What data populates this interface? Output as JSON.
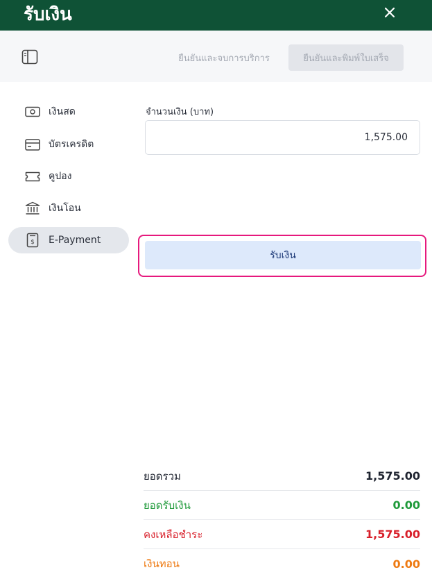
{
  "header": {
    "title": "รับเงิน",
    "close_glyph": "✕"
  },
  "toolbar": {
    "confirm_finish_label": "ยืนยันและจบการบริการ",
    "confirm_print_label": "ยืนยันและพิมพ์ใบเสร็จ"
  },
  "methods": [
    {
      "label": "เงินสด",
      "icon": "cash-icon",
      "active": false
    },
    {
      "label": "บัตรเครดิต",
      "icon": "credit-card-icon",
      "active": false
    },
    {
      "label": "คูปอง",
      "icon": "coupon-icon",
      "active": false
    },
    {
      "label": "เงินโอน",
      "icon": "bank-icon",
      "active": false
    },
    {
      "label": "E-Payment",
      "icon": "receipt-icon",
      "active": true
    }
  ],
  "form": {
    "amount_label": "จำนวนเงิน (บาท)",
    "amount_value": "1,575.00",
    "receive_button": "รับเงิน"
  },
  "summary": [
    {
      "label": "ยอดรวม",
      "value": "1,575.00",
      "color": "#1f2430"
    },
    {
      "label": "ยอดรับเงิน",
      "value": "0.00",
      "color": "#1f9a3a"
    },
    {
      "label": "คงเหลือชำระ",
      "value": "1,575.00",
      "color": "#d81f2a"
    },
    {
      "label": "เงินทอน",
      "value": "0.00",
      "color": "#ee7a12"
    }
  ],
  "colors": {
    "header_bg": "#0f5236",
    "highlight": "#e6197d",
    "primary_btn_bg": "#dde9fb"
  }
}
